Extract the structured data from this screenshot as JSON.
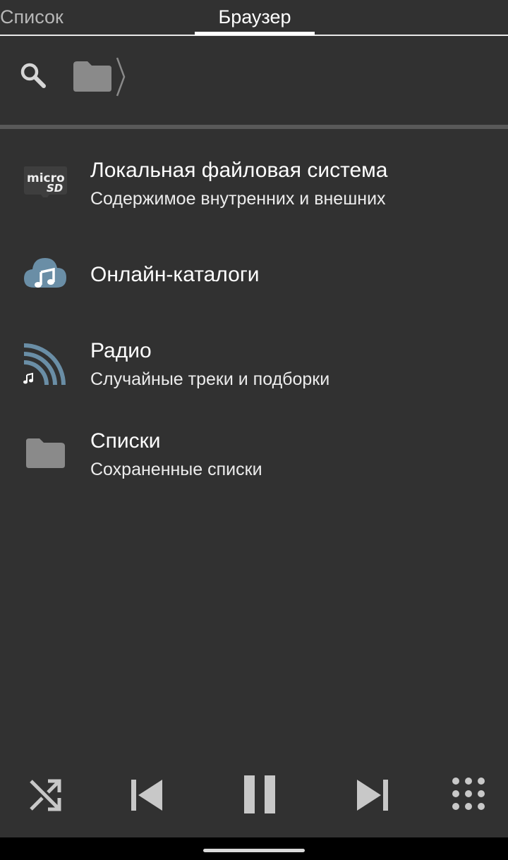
{
  "tabs": [
    {
      "label": "Список",
      "active": false
    },
    {
      "label": "Браузер",
      "active": true
    }
  ],
  "toolbar": {
    "search_icon": "search-icon",
    "breadcrumb_root_icon": "folder-icon"
  },
  "items": [
    {
      "title": "Локальная файловая система",
      "subtitle": "Содержимое внутренних и внешних",
      "icon": "microsd-icon"
    },
    {
      "title": "Онлайн-каталоги",
      "subtitle": "",
      "icon": "cloud-music-icon"
    },
    {
      "title": "Радио",
      "subtitle": "Случайные треки и подборки",
      "icon": "radio-icon"
    },
    {
      "title": "Списки",
      "subtitle": "Сохраненные списки",
      "icon": "folder-icon"
    }
  ],
  "player": {
    "buttons": [
      "shuffle-icon",
      "skip-previous-icon",
      "pause-icon",
      "skip-next-icon",
      "grid-menu-icon"
    ]
  },
  "colors": {
    "background": "#313131",
    "separator": "#595959",
    "icon_gray": "#8a8a8a",
    "accent_blue": "#6a8ea6",
    "text_primary": "#ffffff",
    "tab_inactive": "#b7b7b7"
  }
}
